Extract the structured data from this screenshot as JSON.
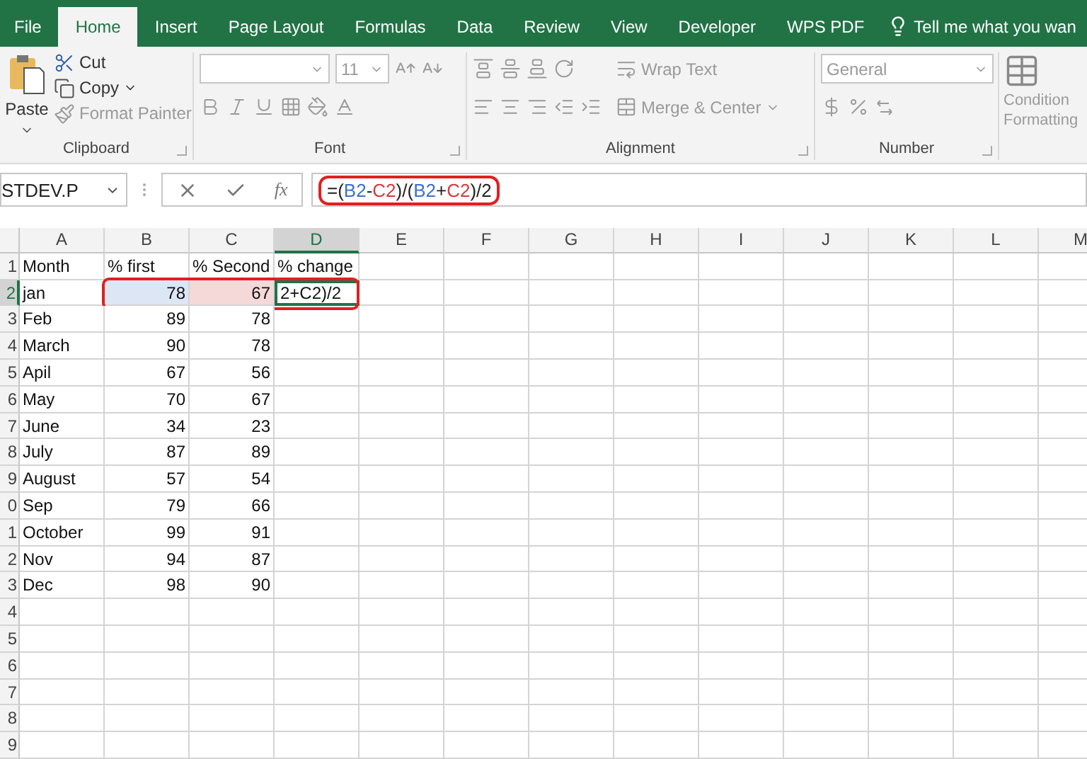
{
  "tabs": [
    {
      "label": "File",
      "selected": false
    },
    {
      "label": "Home",
      "selected": true
    },
    {
      "label": "Insert",
      "selected": false
    },
    {
      "label": "Page Layout",
      "selected": false
    },
    {
      "label": "Formulas",
      "selected": false
    },
    {
      "label": "Data",
      "selected": false
    },
    {
      "label": "Review",
      "selected": false
    },
    {
      "label": "View",
      "selected": false
    },
    {
      "label": "Developer",
      "selected": false
    },
    {
      "label": "WPS PDF",
      "selected": false
    }
  ],
  "tell_me": "Tell me what you wan",
  "clipboard": {
    "paste": "Paste",
    "cut": "Cut",
    "copy": "Copy",
    "format_painter": "Format Painter",
    "label": "Clipboard"
  },
  "font": {
    "size": "11",
    "label": "Font"
  },
  "alignment": {
    "wrap": "Wrap Text",
    "merge": "Merge & Center",
    "label": "Alignment"
  },
  "number": {
    "format": "General",
    "label": "Number"
  },
  "styles": {
    "line_1": "Condition",
    "line_2": "Formatting"
  },
  "formula_bar": {
    "name_box": "STDEV.P",
    "fx": "fx",
    "outlined": true,
    "formula": [
      {
        "text": "=(",
        "color": "#222222"
      },
      {
        "text": "B2",
        "color": "#3a6fd8"
      },
      {
        "text": "-",
        "color": "#222222"
      },
      {
        "text": "C2",
        "color": "#d83a3a"
      },
      {
        "text": ")/(",
        "color": "#222222"
      },
      {
        "text": "B2",
        "color": "#3a6fd8"
      },
      {
        "text": "+",
        "color": "#222222"
      },
      {
        "text": "C2",
        "color": "#d83a3a"
      },
      {
        "text": ")/2",
        "color": "#222222"
      }
    ]
  },
  "columns": [
    {
      "label": "A",
      "selected": false
    },
    {
      "label": "B",
      "selected": false
    },
    {
      "label": "C",
      "selected": false
    },
    {
      "label": "D",
      "selected": true
    },
    {
      "label": "E",
      "selected": false
    },
    {
      "label": "F",
      "selected": false
    },
    {
      "label": "G",
      "selected": false
    },
    {
      "label": "H",
      "selected": false
    },
    {
      "label": "I",
      "selected": false
    },
    {
      "label": "J",
      "selected": false
    },
    {
      "label": "K",
      "selected": false
    },
    {
      "label": "L",
      "selected": false
    },
    {
      "label": "M",
      "selected": false
    }
  ],
  "rows": [
    {
      "header": "1",
      "selected": false,
      "cells": [
        {
          "kind": "text",
          "value": "Month"
        },
        {
          "kind": "text",
          "value": "% first"
        },
        {
          "kind": "text",
          "value": "% Second"
        },
        {
          "kind": "text",
          "value": "% change"
        }
      ]
    },
    {
      "header": "2",
      "selected": true,
      "outlined": true,
      "cells": [
        {
          "kind": "text",
          "value": "jan"
        },
        {
          "kind": "number",
          "value": "78",
          "color": "#dce6f5"
        },
        {
          "kind": "number",
          "value": "67",
          "color": "#f5d9d9"
        },
        {
          "kind": "editing",
          "value": "2+C2)/2"
        }
      ]
    },
    {
      "header": "3",
      "selected": false,
      "cells": [
        {
          "kind": "text",
          "value": "Feb"
        },
        {
          "kind": "number",
          "value": "89"
        },
        {
          "kind": "number",
          "value": "78"
        }
      ]
    },
    {
      "header": "4",
      "selected": false,
      "cells": [
        {
          "kind": "text",
          "value": "March"
        },
        {
          "kind": "number",
          "value": "90"
        },
        {
          "kind": "number",
          "value": "78"
        }
      ]
    },
    {
      "header": "5",
      "selected": false,
      "cells": [
        {
          "kind": "text",
          "value": "Apil"
        },
        {
          "kind": "number",
          "value": "67"
        },
        {
          "kind": "number",
          "value": "56"
        }
      ]
    },
    {
      "header": "6",
      "selected": false,
      "cells": [
        {
          "kind": "text",
          "value": "May"
        },
        {
          "kind": "number",
          "value": "70"
        },
        {
          "kind": "number",
          "value": "67"
        }
      ]
    },
    {
      "header": "7",
      "selected": false,
      "cells": [
        {
          "kind": "text",
          "value": "June"
        },
        {
          "kind": "number",
          "value": "34"
        },
        {
          "kind": "number",
          "value": "23"
        }
      ]
    },
    {
      "header": "8",
      "selected": false,
      "cells": [
        {
          "kind": "text",
          "value": "July"
        },
        {
          "kind": "number",
          "value": "87"
        },
        {
          "kind": "number",
          "value": "89"
        }
      ]
    },
    {
      "header": "9",
      "selected": false,
      "cells": [
        {
          "kind": "text",
          "value": "August"
        },
        {
          "kind": "number",
          "value": "57"
        },
        {
          "kind": "number",
          "value": "54"
        }
      ]
    },
    {
      "header": "0",
      "selected": false,
      "cells": [
        {
          "kind": "text",
          "value": "Sep"
        },
        {
          "kind": "number",
          "value": "79"
        },
        {
          "kind": "number",
          "value": "66"
        }
      ]
    },
    {
      "header": "1",
      "selected": false,
      "cells": [
        {
          "kind": "text",
          "value": "October"
        },
        {
          "kind": "number",
          "value": "99"
        },
        {
          "kind": "number",
          "value": "91"
        }
      ]
    },
    {
      "header": "2",
      "selected": false,
      "cells": [
        {
          "kind": "text",
          "value": "Nov"
        },
        {
          "kind": "number",
          "value": "94"
        },
        {
          "kind": "number",
          "value": "87"
        }
      ]
    },
    {
      "header": "3",
      "selected": false,
      "cells": [
        {
          "kind": "text",
          "value": "Dec"
        },
        {
          "kind": "number",
          "value": "98"
        },
        {
          "kind": "number",
          "value": "90"
        }
      ]
    },
    {
      "header": "4",
      "selected": false,
      "cells": []
    },
    {
      "header": "5",
      "selected": false,
      "cells": []
    },
    {
      "header": "6",
      "selected": false,
      "cells": []
    },
    {
      "header": "7",
      "selected": false,
      "cells": []
    },
    {
      "header": "8",
      "selected": false,
      "cells": []
    },
    {
      "header": "9",
      "selected": false,
      "cells": []
    }
  ]
}
